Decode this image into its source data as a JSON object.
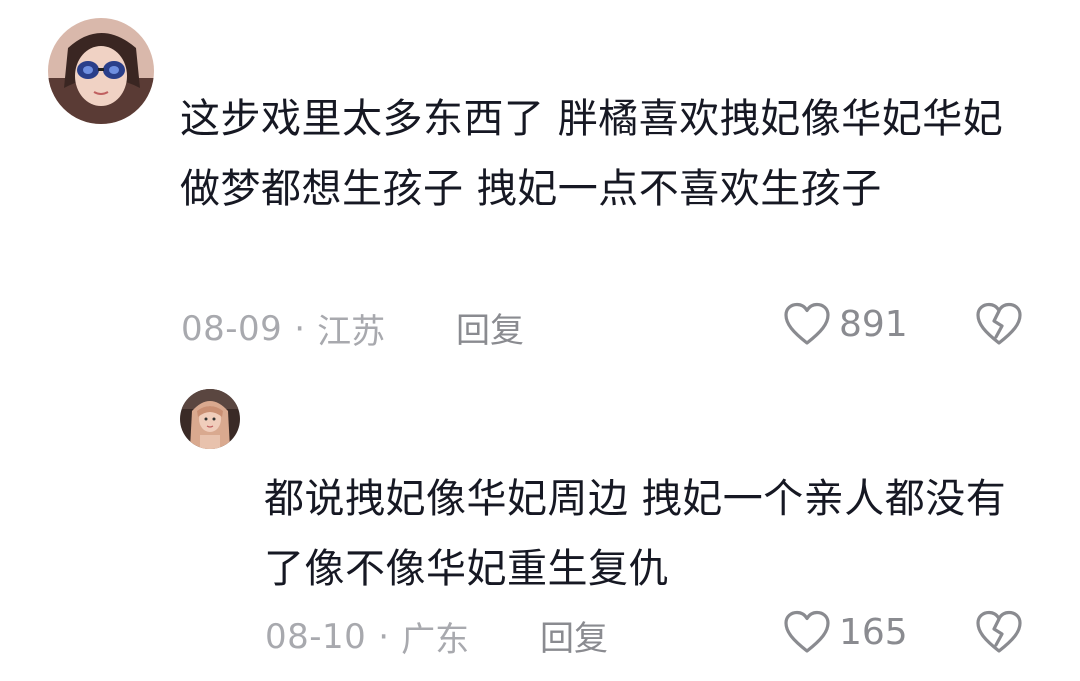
{
  "comments": [
    {
      "text": "这步戏里太多东西了 胖橘喜欢拽妃像华妃华妃做梦都想生孩子 拽妃一点不喜欢生孩子",
      "date": "08-09",
      "location": "江苏",
      "reply_label": "回复",
      "likes": "891",
      "avatar_icon": "user-avatar-sunglasses",
      "colors": {
        "avatar_bg": "#caa89a",
        "avatar_glasses": "#2a3f8a"
      }
    },
    {
      "text": "都说拽妃像华妃周边 拽妃一个亲人都没有了像不像华妃重生复仇",
      "date": "08-10",
      "location": "广东",
      "reply_label": "回复",
      "likes": "165",
      "avatar_icon": "user-avatar-girl",
      "colors": {
        "avatar_bg": "#3a2a26",
        "avatar_face": "#e8c2ad"
      }
    }
  ],
  "separator": "·",
  "icons": {
    "like": "heart-outline-icon",
    "dislike": "broken-heart-icon"
  },
  "colors": {
    "text": "#161823",
    "meta": "#a8a9ae",
    "action": "#8a8b90"
  }
}
